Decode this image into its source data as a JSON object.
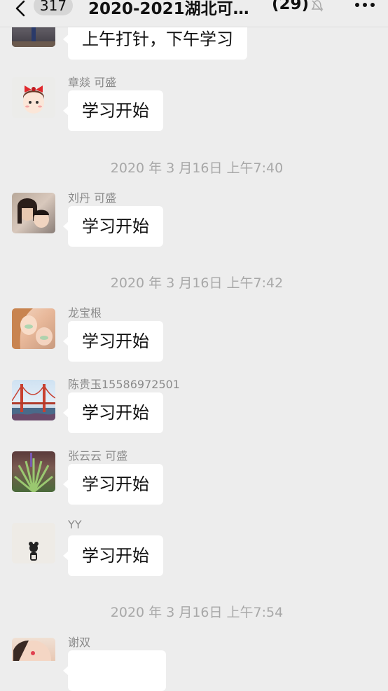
{
  "header": {
    "unread_count": "317",
    "title": "2020-2021湖北可…",
    "member_count": "(29)"
  },
  "messages": [
    {
      "sender": "",
      "text": "上午打针，下午学习"
    },
    {
      "sender": "章燚 可盛",
      "text": "学习开始"
    },
    {
      "sender": "刘丹 可盛",
      "text": "学习开始"
    },
    {
      "sender": "龙宝根",
      "text": "学习开始"
    },
    {
      "sender": "陈贵玉15586972501",
      "text": "学习开始"
    },
    {
      "sender": "张云云 可盛",
      "text": "学习开始"
    },
    {
      "sender": "YY",
      "text": "学习开始"
    },
    {
      "sender": "谢双",
      "text": ""
    }
  ],
  "timestamps": [
    "2020 年 3 月16日 上午7:40",
    "2020 年 3 月16日 上午7:42",
    "2020 年 3 月16日 上午7:54"
  ],
  "colors": {
    "background": "#ededed",
    "bubble": "#ffffff",
    "sender_text": "#8a8a8a",
    "timestamp_text": "#a8a8a8"
  },
  "icons": {
    "back": "chevron-left-icon",
    "mute": "mute-bell-icon",
    "more": "more-dots-icon"
  }
}
